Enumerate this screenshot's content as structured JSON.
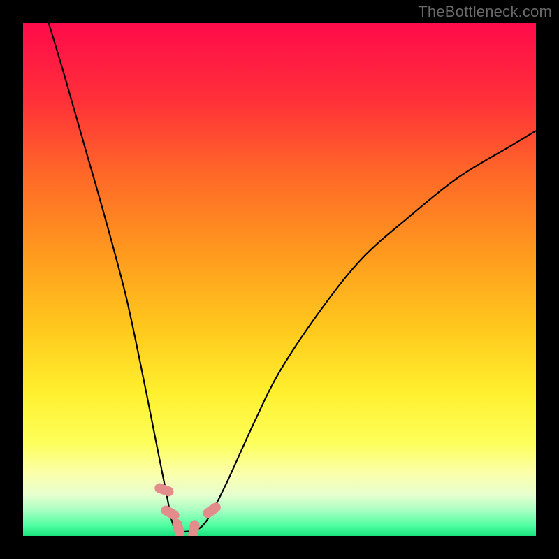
{
  "watermark": "TheBottleneck.com",
  "chart_data": {
    "type": "line",
    "title": "",
    "xlabel": "",
    "ylabel": "",
    "xlim": [
      0,
      100
    ],
    "ylim": [
      0,
      100
    ],
    "background_gradient": {
      "type": "vertical-rainbow",
      "stops": [
        {
          "pos": 0.0,
          "color": "#ff0b4b"
        },
        {
          "pos": 0.15,
          "color": "#ff3039"
        },
        {
          "pos": 0.3,
          "color": "#ff6a27"
        },
        {
          "pos": 0.45,
          "color": "#ff9a1e"
        },
        {
          "pos": 0.6,
          "color": "#ffca1d"
        },
        {
          "pos": 0.72,
          "color": "#fff02e"
        },
        {
          "pos": 0.82,
          "color": "#fdff5b"
        },
        {
          "pos": 0.88,
          "color": "#fbffad"
        },
        {
          "pos": 0.92,
          "color": "#e6ffcf"
        },
        {
          "pos": 0.95,
          "color": "#a8ffc2"
        },
        {
          "pos": 0.98,
          "color": "#4effa0"
        },
        {
          "pos": 1.0,
          "color": "#19e07c"
        }
      ]
    },
    "series": [
      {
        "name": "bottleneck-curve",
        "color": "#000000",
        "points": [
          {
            "x": 5.0,
            "y": 100.0
          },
          {
            "x": 8.0,
            "y": 90.0
          },
          {
            "x": 12.0,
            "y": 76.0
          },
          {
            "x": 16.0,
            "y": 62.0
          },
          {
            "x": 20.0,
            "y": 47.0
          },
          {
            "x": 23.0,
            "y": 33.0
          },
          {
            "x": 26.0,
            "y": 18.0
          },
          {
            "x": 28.0,
            "y": 8.0
          },
          {
            "x": 29.0,
            "y": 3.0
          },
          {
            "x": 30.0,
            "y": 1.0
          },
          {
            "x": 33.0,
            "y": 1.0
          },
          {
            "x": 35.0,
            "y": 2.0
          },
          {
            "x": 37.0,
            "y": 5.0
          },
          {
            "x": 40.0,
            "y": 11.0
          },
          {
            "x": 45.0,
            "y": 22.0
          },
          {
            "x": 50.0,
            "y": 32.0
          },
          {
            "x": 58.0,
            "y": 44.0
          },
          {
            "x": 66.0,
            "y": 54.0
          },
          {
            "x": 75.0,
            "y": 62.0
          },
          {
            "x": 85.0,
            "y": 70.0
          },
          {
            "x": 95.0,
            "y": 76.0
          },
          {
            "x": 100.0,
            "y": 79.0
          }
        ]
      }
    ],
    "markers": [
      {
        "name": "marker-1",
        "x": 27.5,
        "y": 9.0,
        "rotation": -70,
        "color": "#e38c8c"
      },
      {
        "name": "marker-2",
        "x": 28.7,
        "y": 4.5,
        "rotation": -60,
        "color": "#e38c8c"
      },
      {
        "name": "marker-3",
        "x": 30.3,
        "y": 1.4,
        "rotation": -15,
        "color": "#e38c8c"
      },
      {
        "name": "marker-4",
        "x": 33.3,
        "y": 1.2,
        "rotation": 10,
        "color": "#e38c8c"
      },
      {
        "name": "marker-5",
        "x": 36.8,
        "y": 5.0,
        "rotation": 55,
        "color": "#e38c8c"
      }
    ]
  }
}
